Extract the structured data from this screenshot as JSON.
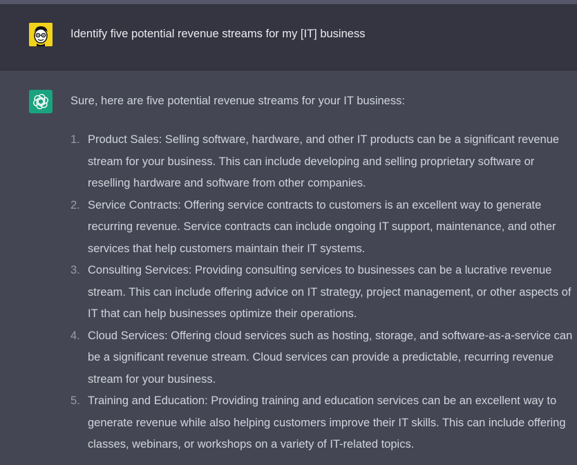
{
  "user_message": {
    "text": "Identify five potential revenue streams for my [IT] business",
    "avatar_icon": "cartoon-face-avatar-icon",
    "avatar_color": "#f2d31b"
  },
  "assistant_message": {
    "avatar_icon": "openai-logo-icon",
    "avatar_color": "#19a37f",
    "intro": "Sure, here are five potential revenue streams for your IT business:",
    "items": [
      {
        "number": "1.",
        "text": "Product Sales: Selling software, hardware, and other IT products can be a significant revenue stream for your business. This can include developing and selling proprietary software or reselling hardware and software from other companies."
      },
      {
        "number": "2.",
        "text": "Service Contracts: Offering service contracts to customers is an excellent way to generate recurring revenue. Service contracts can include ongoing IT support, maintenance, and other services that help customers maintain their IT systems."
      },
      {
        "number": "3.",
        "text": "Consulting Services: Providing consulting services to businesses can be a lucrative revenue stream. This can include offering advice on IT strategy, project management, or other aspects of IT that can help businesses optimize their operations."
      },
      {
        "number": "4.",
        "text": "Cloud Services: Offering cloud services such as hosting, storage, and software-as-a-service can be a significant revenue stream. Cloud services can provide a predictable, recurring revenue stream for your business."
      },
      {
        "number": "5.",
        "text": "Training and Education: Providing training and education services can be an excellent way to generate revenue while also helping customers improve their IT skills. This can include offering classes, webinars, or workshops on a variety of IT-related topics."
      }
    ]
  },
  "colors": {
    "user_bg": "#343541",
    "assistant_bg": "#444654",
    "text": "#d1d5db"
  }
}
